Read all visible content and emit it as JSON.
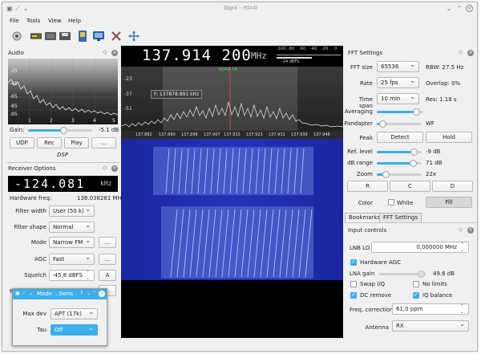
{
  "window": {
    "title": "Gqrx - rtl=0"
  },
  "menu": [
    "File",
    "Tools",
    "View",
    "Help"
  ],
  "toolbar_icons": [
    "power-icon",
    "device-icon",
    "open-icon",
    "save-icon",
    "screenshot-icon",
    "remote-icon",
    "tools-icon",
    "fullscreen-icon"
  ],
  "audio": {
    "title": "Audio",
    "db_labels": [
      "-25",
      "-45",
      "-65",
      "-85",
      "-95"
    ],
    "freq_labels": [
      "1",
      "2",
      "3",
      "4",
      "5"
    ],
    "gain_label": "Gain:",
    "gain_value": "-5.1 dB",
    "gain_level": 0.55,
    "buttons": [
      "UDP",
      "Rec",
      "Play",
      "..."
    ],
    "dsp_label": "DSP"
  },
  "receiver": {
    "title": "Receiver Options",
    "offset": "-124.081",
    "offset_unit": "kHz",
    "hw_freq_label": "Hardware freq:",
    "hw_freq_value": "138.038281 MHz",
    "filter_width_label": "Filter width",
    "filter_width_value": "User (50 k)",
    "filter_shape_label": "Filter shape",
    "filter_shape_value": "Normal",
    "mode_label": "Mode",
    "mode_value": "Narrow FM",
    "agc_label": "AGC",
    "agc_value": "Fast",
    "squelch_label": "Squelch",
    "squelch_value": "-45,8 dBFS",
    "squelch_btn": "A",
    "more_btn": "...",
    "cut_label": "N"
  },
  "popup": {
    "title": "Mode ...tions",
    "max_dev_label": "Max dev",
    "max_dev_value": "APT (17k)",
    "tau_label": "Tau",
    "tau_value": "Off"
  },
  "spectrum": {
    "frequency": "137.914 200",
    "unit": "MHz",
    "smeter_ticks": [
      "-100",
      "-80",
      "-60",
      "-40",
      "-20",
      "0"
    ],
    "smeter_label": "-24 dBFS",
    "db_labels": [
      "-23",
      "-37",
      "-51"
    ],
    "marker_label": "NOAA-18",
    "cursor_readout": "F: 137878.891 kHz",
    "freq_ticks": [
      "137.882",
      "137.890",
      "137.898",
      "137.907",
      "137.915",
      "137.923",
      "137.931",
      "137.939",
      "137.948"
    ]
  },
  "fft": {
    "title": "FFT Settings",
    "fft_size_label": "FFT size",
    "fft_size_value": "65536",
    "rbw": "RBW: 27.5 Hz",
    "rate_label": "Rate",
    "rate_value": "25 fps",
    "overlap": "Overlap: 0%",
    "timespan_label": "Time span",
    "timespan_value": "10 min",
    "res": "Res: 1.18 s",
    "averaging_label": "Averaging",
    "averaging_level": 0.85,
    "pandapter_label": "Pandapter",
    "pandapter_level": 0.12,
    "wf_label": "WF",
    "peak_label": "Peak",
    "detect_btn": "Detect",
    "hold_btn": "Hold",
    "ref_label": "Ref. level",
    "ref_value": "-9 dB",
    "ref_level": 0.82,
    "range_label": "dB range",
    "range_value": "71 dB",
    "range_level": 0.8,
    "zoom_label": "Zoom",
    "zoom_value": "22x",
    "zoom_level": 0.2,
    "r_btn": "R",
    "c_btn": "C",
    "d_btn": "D",
    "color_label": "Color",
    "white_label": "White",
    "fill_btn": "Fill"
  },
  "tabs": [
    "Bookmarks",
    "FFT Settings"
  ],
  "input": {
    "title": "Input controls",
    "lnb_label": "LNB LO",
    "lnb_value": "0,000000 MHz",
    "hw_agc_label": "Hardware AGC",
    "lna_label": "LNA gain",
    "lna_value": "49.6 dB",
    "lna_level": 0.9,
    "swap_label": "Swap I/Q",
    "nolimits_label": "No limits",
    "dc_label": "DC remove",
    "iq_label": "IQ balance",
    "freq_corr_label": "Freq. correction",
    "freq_corr_value": "61,0 ppm",
    "antenna_label": "Antenna",
    "antenna_value": "RX"
  },
  "colors": {
    "accent": "#3daee9",
    "waterfall_bg": "#1a2a9a",
    "lcd_bg": "#000000"
  }
}
